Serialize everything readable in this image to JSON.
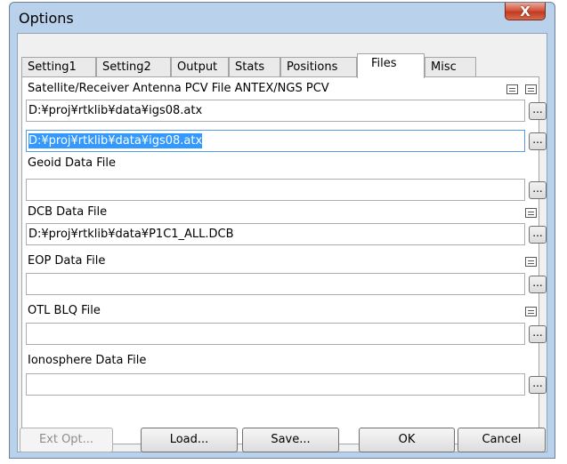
{
  "window": {
    "title": "Options",
    "close_glyph": "X"
  },
  "tabs": [
    {
      "label": "Setting1"
    },
    {
      "label": "Setting2"
    },
    {
      "label": "Output"
    },
    {
      "label": "Stats"
    },
    {
      "label": "Positions"
    },
    {
      "label": "Files",
      "active": true
    },
    {
      "label": "Misc"
    }
  ],
  "files": {
    "antenna_label": "Satellite/Receiver Antenna PCV File ANTEX/NGS PCV",
    "antenna_sat_value": "D:¥proj¥rtklib¥data¥igs08.atx",
    "antenna_rcv_value": "D:¥proj¥rtklib¥data¥igs08.atx",
    "geoid_label": "Geoid Data File",
    "geoid_value": "",
    "dcb_label": "DCB Data File",
    "dcb_value": "D:¥proj¥rtklib¥data¥P1C1_ALL.DCB",
    "eop_label": "EOP Data File",
    "eop_value": "",
    "otl_label": "OTL BLQ File",
    "otl_value": "",
    "iono_label": "Ionosphere Data File",
    "iono_value": "",
    "browse_label": "..."
  },
  "buttons": {
    "ext_opt": "Ext Opt...",
    "load": "Load...",
    "save": "Save...",
    "ok": "OK",
    "cancel": "Cancel"
  },
  "icons": {
    "view": "view-file-icon",
    "browse": "browse-ellipsis",
    "close": "close-icon"
  },
  "colors": {
    "selection": "#3399ff",
    "titlebar": "#b9d1ea",
    "close": "#c23b20"
  }
}
